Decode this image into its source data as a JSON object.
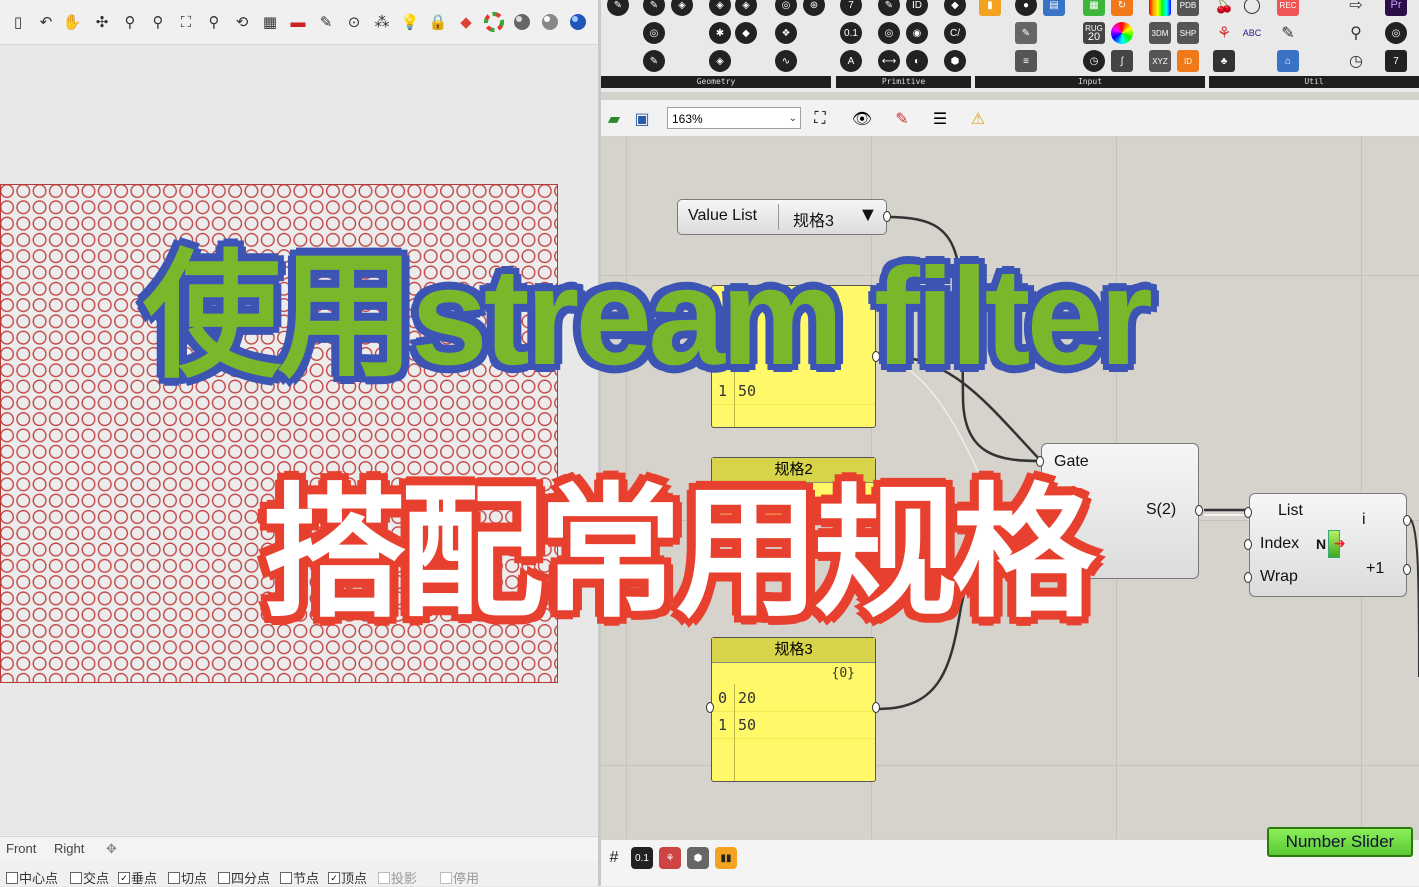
{
  "rhino": {
    "viewport_tabs": [
      "Front",
      "Right",
      "✥"
    ],
    "osnaps": [
      {
        "label": "中心点",
        "checked": false
      },
      {
        "label": "交点",
        "checked": false
      },
      {
        "label": "垂点",
        "checked": true
      },
      {
        "label": "切点",
        "checked": false
      },
      {
        "label": "四分点",
        "checked": false
      },
      {
        "label": "节点",
        "checked": false
      },
      {
        "label": "顶点",
        "checked": true
      },
      {
        "label": "投影",
        "checked": false,
        "disabled": true
      },
      {
        "label": "停用",
        "checked": false,
        "disabled": true
      }
    ]
  },
  "gh": {
    "ribbon_panels": [
      "Geometry",
      "Primitive",
      "Input",
      "Util"
    ],
    "ribbon_icon_labels": {
      "rug": "RUG",
      "twenty": "20",
      "threedm": "3DM",
      "shp": "SHP",
      "pdb": "PDB",
      "xyz": "XYZ",
      "abc": "ABC",
      "rec": "REC",
      "pr": "Pr",
      "id": "ID",
      "cv": "C/",
      "zeroone": "0.1",
      "a": "A"
    },
    "zoom": "163%",
    "value_list": {
      "label": "Value List",
      "selected": "规格3",
      "arrow": "▼"
    },
    "panel1": {
      "path_partial": "",
      "rows": [
        {
          "i": "1",
          "v": "50"
        }
      ]
    },
    "panel2": {
      "title": "规格2"
    },
    "panel3": {
      "title": "规格3",
      "path": "{0}",
      "rows": [
        {
          "i": "0",
          "v": "20"
        },
        {
          "i": "1",
          "v": "50"
        }
      ]
    },
    "gate": {
      "input": "Gate",
      "output": "S(2)"
    },
    "list_item": {
      "inputs": [
        "List",
        "Index",
        "Wrap"
      ],
      "outputs": [
        "i",
        "+1"
      ],
      "mid": "N"
    },
    "number_slider": "Number Slider",
    "bottom_icons": [
      "grid",
      "0.1",
      "tree",
      "hex",
      "bars"
    ]
  },
  "overlay": {
    "title_line1": "使用stream filter",
    "title_line2": "搭配常用规格"
  },
  "colors": {
    "title1_fill": "#78b82a",
    "title1_stroke": "#3c54b4",
    "title2_fill": "#ffffff",
    "title2_stroke": "#e8402e",
    "panel_yellow": "#fff96a",
    "circle_red": "#c24646"
  },
  "rhino_toolbar_icons": [
    "new-icon",
    "undo-icon",
    "pan-icon",
    "rotate-icon",
    "zoom-icon",
    "zoom-window-icon",
    "zoom-extents-icon",
    "zoom-selected-icon",
    "undo-view-icon",
    "four-viewports-icon",
    "car-icon",
    "properties-icon",
    "snap-icon",
    "points-icon",
    "light-icon",
    "lock-icon",
    "render-icon",
    "color-wheel-icon",
    "shaded-sphere-icon",
    "rendered-sphere-icon",
    "blue-sphere-icon"
  ]
}
